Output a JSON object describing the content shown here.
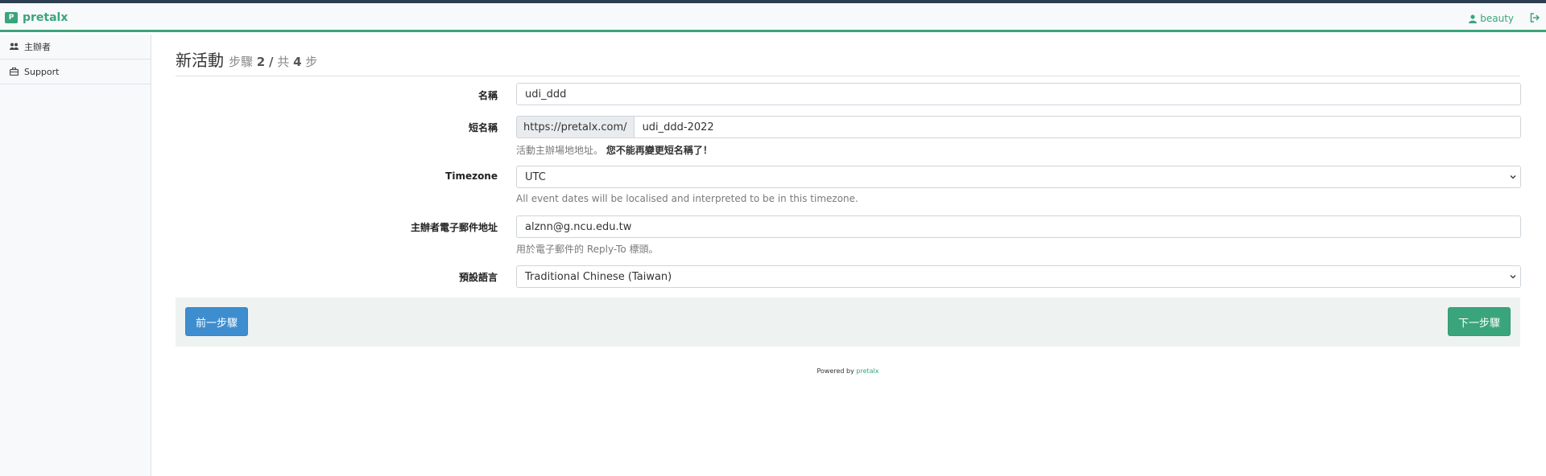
{
  "navbar": {
    "brand_logo": "P",
    "brand_name": "pretalx",
    "username": "beauty",
    "accent_color": "#3aa57c"
  },
  "sidebar": {
    "items": [
      {
        "label": "主辦者",
        "icon": "users-icon"
      },
      {
        "label": "Support",
        "icon": "briefcase-icon"
      }
    ]
  },
  "page": {
    "title": "新活動",
    "step_prefix": "步驟",
    "step_current": "2",
    "step_sep": "/",
    "step_total_prefix": "共",
    "step_total": "4",
    "step_suffix": "步"
  },
  "form": {
    "name": {
      "label": "名稱",
      "value": "udi_ddd"
    },
    "slug": {
      "label": "短名稱",
      "prefix": "https://pretalx.com/",
      "value": "udi_ddd-2022",
      "help": "活動主辦場地地址。",
      "help_strong": "您不能再變更短名稱了！"
    },
    "timezone": {
      "label": "Timezone",
      "value": "UTC",
      "help": "All event dates will be localised and interpreted to be in this timezone."
    },
    "email": {
      "label": "主辦者電子郵件地址",
      "value": "alznn@g.ncu.edu.tw",
      "help": "用於電子郵件的 Reply-To 標頭。"
    },
    "locale": {
      "label": "預設語言",
      "value": "Traditional Chinese (Taiwan)"
    }
  },
  "actions": {
    "prev_label": "前一步驟",
    "next_label": "下一步驟"
  },
  "footer": {
    "powered_by": "Powered by",
    "link": "pretalx"
  }
}
